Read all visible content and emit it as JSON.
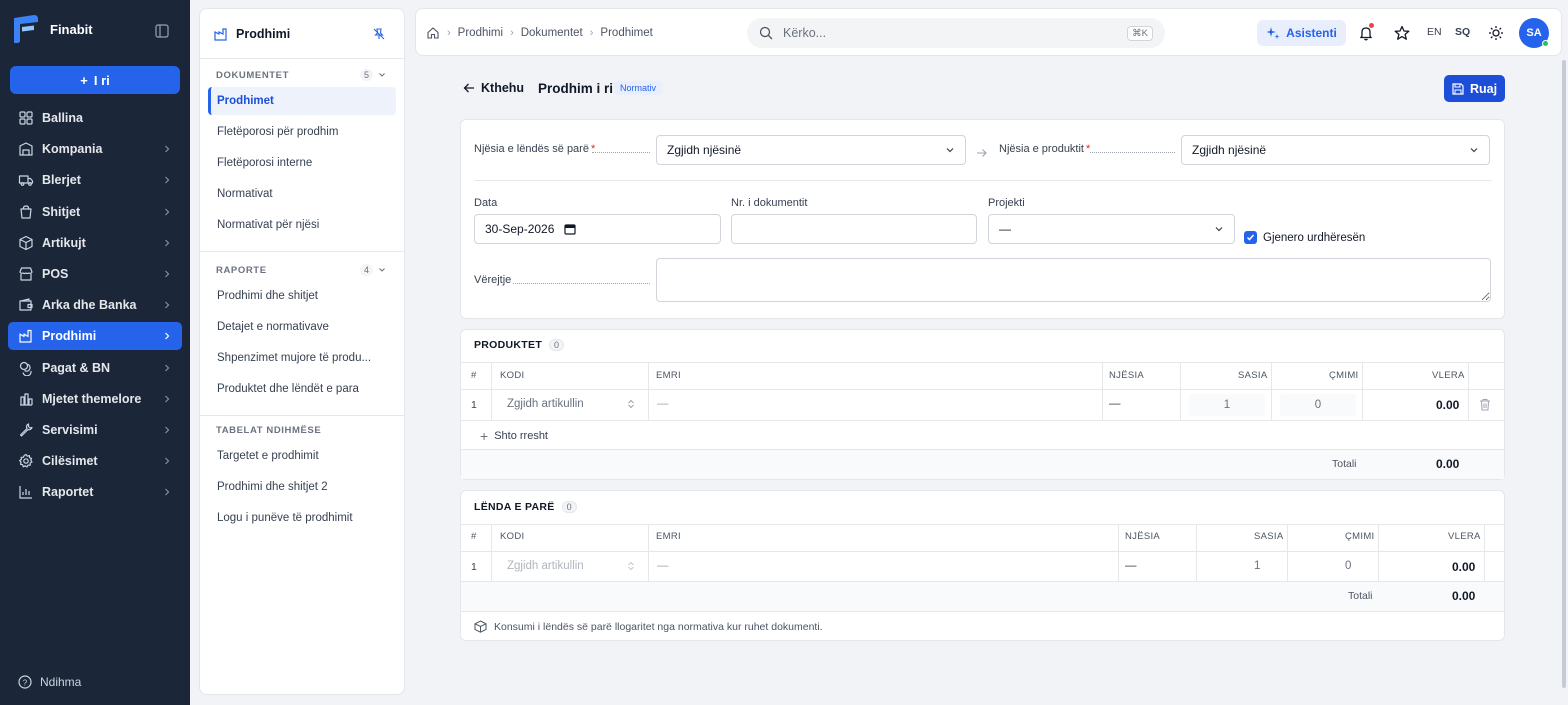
{
  "app": {
    "name": "Finabit"
  },
  "sidebar": {
    "new_label": "I ri",
    "items": [
      {
        "label": "Ballina",
        "icon": "dashboard-icon"
      },
      {
        "label": "Kompania",
        "icon": "building-icon"
      },
      {
        "label": "Blerjet",
        "icon": "truck-icon"
      },
      {
        "label": "Shitjet",
        "icon": "shopping-bag-icon"
      },
      {
        "label": "Artikujt",
        "icon": "box-icon"
      },
      {
        "label": "POS",
        "icon": "store-icon"
      },
      {
        "label": "Arka dhe Banka",
        "icon": "wallet-icon"
      },
      {
        "label": "Prodhimi",
        "icon": "factory-icon",
        "active": true
      },
      {
        "label": "Pagat & BN",
        "icon": "coins-icon"
      },
      {
        "label": "Mjetet themelore",
        "icon": "assets-icon"
      },
      {
        "label": "Servisimi",
        "icon": "wrench-icon"
      },
      {
        "label": "Cilësimet",
        "icon": "gear-icon"
      },
      {
        "label": "Raportet",
        "icon": "chart-icon"
      }
    ],
    "help_label": "Ndihma"
  },
  "subnav": {
    "title": "Prodhimi",
    "sections": [
      {
        "title": "DOKUMENTET",
        "count": "5",
        "items": [
          "Prodhimet",
          "Fletëporosi për prodhim",
          "Fletëporosi interne",
          "Normativat",
          "Normativat për njësi"
        ]
      },
      {
        "title": "RAPORTE",
        "count": "4",
        "items": [
          "Prodhimi dhe shitjet",
          "Detajet e normativave",
          "Shpenzimet mujore të produ...",
          "Produktet dhe lëndët e para"
        ]
      },
      {
        "title": "TABELAT NDIHMËSE",
        "items": [
          "Targetet e prodhimit",
          "Prodhimi dhe shitjet 2",
          "Logu i punëve të prodhimit"
        ]
      }
    ]
  },
  "topbar": {
    "breadcrumb": [
      "Prodhimi",
      "Dokumentet",
      "Prodhimet"
    ],
    "search_placeholder": "Kërko...",
    "search_shortcut": "⌘K",
    "assistant_label": "Asistenti",
    "lang_en": "EN",
    "lang_sq": "SQ",
    "avatar_initials": "SA"
  },
  "page": {
    "back_label": "Kthehu",
    "title": "Prodhim i ri",
    "badge": "Normativ",
    "save_label": "Ruaj"
  },
  "form": {
    "raw_unit_label": "Njësia e lëndës së parë",
    "raw_unit_value": "Zgjidh njësinë",
    "product_unit_label": "Njësia e produktit",
    "product_unit_value": "Zgjidh njësinë",
    "date_label": "Data",
    "date_value": "30-Sep-2026",
    "docnum_label": "Nr. i dokumentit",
    "docnum_value": "",
    "project_label": "Projekti",
    "project_value": "—",
    "generate_label": "Gjenero urdhëresën",
    "generate_checked": true,
    "notes_label": "Vërejtje",
    "notes_value": ""
  },
  "products": {
    "title": "PRODUKTET",
    "count": "0",
    "columns": [
      "#",
      "KODI",
      "EMRI",
      "NJËSIA",
      "SASIA",
      "ÇMIMI",
      "VLERA"
    ],
    "rows": [
      {
        "num": "1",
        "code": "Zgjidh artikullin",
        "name": "—",
        "unit": "—",
        "qty": "1",
        "price": "0",
        "value": "0.00"
      }
    ],
    "add_row_label": "Shto rresht",
    "total_label": "Totali",
    "total_value": "0.00"
  },
  "materials": {
    "title": "LËNDA E PARË",
    "count": "0",
    "columns": [
      "#",
      "KODI",
      "EMRI",
      "NJËSIA",
      "SASIA",
      "ÇMIMI",
      "VLERA"
    ],
    "rows": [
      {
        "num": "1",
        "code": "Zgjidh artikullin",
        "name": "—",
        "unit": "—",
        "qty": "1",
        "price": "0",
        "value": "0.00"
      }
    ],
    "total_label": "Totali",
    "total_value": "0.00",
    "info_text": "Konsumi i lëndës së parë llogaritet nga normativa kur ruhet dokumenti."
  },
  "colors": {
    "sidebar_bg": "#1b2638",
    "accent": "#2563eb",
    "danger": "#dc2626"
  }
}
